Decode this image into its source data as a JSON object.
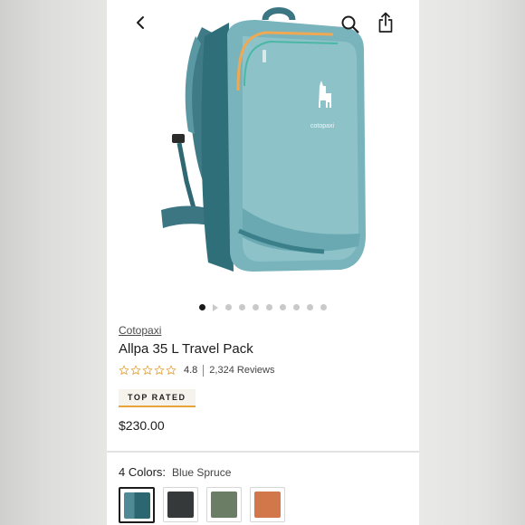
{
  "nav": {
    "back_icon": "chevron-left-icon",
    "search_icon": "search-icon",
    "share_icon": "share-icon"
  },
  "gallery": {
    "image": "backpack-product-photo",
    "logo_text": "cotopaxi",
    "total_dots": 10,
    "active_index": 0
  },
  "product": {
    "brand": "Cotopaxi",
    "title": "Allpa 35 L Travel Pack",
    "rating": "4.8",
    "rating_stars": 4.8,
    "reviews": "2,324 Reviews",
    "badge": "TOP RATED",
    "price": "$230.00"
  },
  "colors": {
    "label": "4 Colors:",
    "selected": "Blue Spruce",
    "swatches": [
      {
        "name": "blue-spruce",
        "color": "#4f8a96",
        "color2": "#2c6670"
      },
      {
        "name": "black",
        "color": "#36393a"
      },
      {
        "name": "sage",
        "color": "#6c7d66"
      },
      {
        "name": "orange",
        "color": "#d2774a"
      }
    ]
  },
  "theme": {
    "accent": "#e8a43a",
    "star_color": "#e0a23a"
  }
}
